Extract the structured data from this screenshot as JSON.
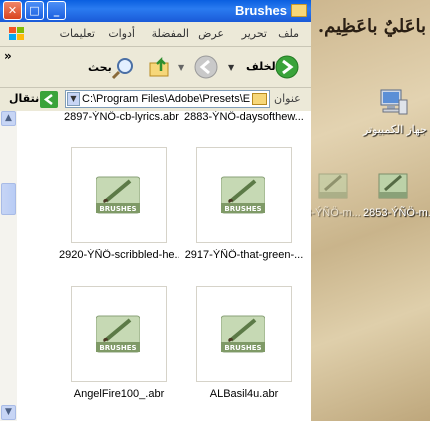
{
  "window": {
    "title": "Brushes",
    "menu": [
      "ملف",
      "تحرير",
      "عرض",
      "المفضلة",
      "أدوات",
      "تعليمات"
    ]
  },
  "toolbar": {
    "back_label": "الخلف",
    "search_label": "بحث"
  },
  "address": {
    "label": "عنوان",
    "path": "C:\\Program Files\\Adobe\\Presets\\E",
    "go_label": "انتقال"
  },
  "files_partial": [
    "2897-ÝNÖ-cb-lyrics.abr",
    "2883-ÝNÖ-daysofthew..."
  ],
  "files": [
    {
      "name": "2920-ÝÑÖ-scribbled-he...",
      "badge": "BRUSHES"
    },
    {
      "name": "2917-ÝÑÖ-that-green-...",
      "badge": "BRUSHES"
    },
    {
      "name": "AngelFire100_.abr",
      "badge": "BRUSHES"
    },
    {
      "name": "ALBasil4u.abr",
      "badge": "BRUSHES"
    }
  ],
  "desktop": {
    "text": "باعَليٌ باعَظِيم.",
    "icons": [
      {
        "label": "جهاز الكمبيوتر",
        "icon": "computer-icon"
      },
      {
        "label": "2853-ÝÑÖ-m...",
        "icon": "brushes-file-icon"
      },
      {
        "label": "3-ÝÑÖ-m...",
        "icon": "brushes-file-icon"
      }
    ]
  },
  "colors": {
    "titlebar": "#0a5fe0",
    "chrome": "#ece9d8",
    "go_green": "#3aa33a",
    "desktop": "#d8c9a6"
  }
}
